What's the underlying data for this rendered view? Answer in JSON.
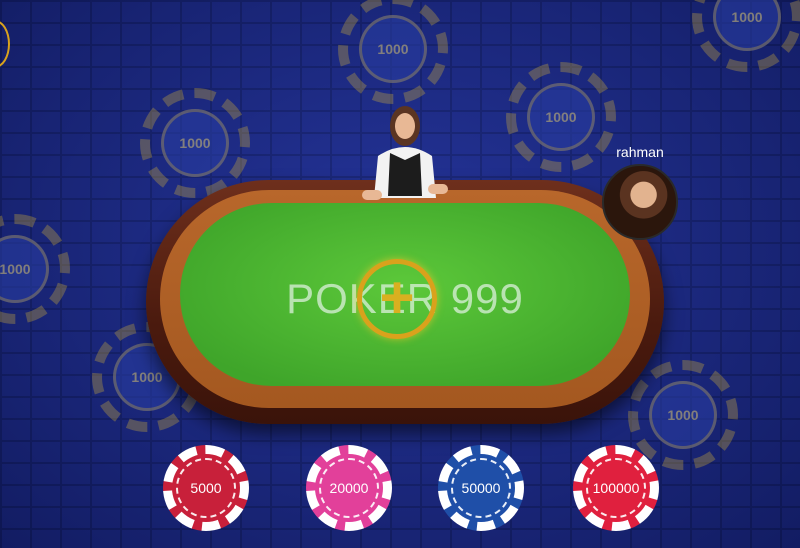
{
  "background_chips": [
    {
      "label": "1000"
    },
    {
      "label": "1000"
    },
    {
      "label": "1000"
    },
    {
      "label": "1000"
    },
    {
      "label": "1000"
    },
    {
      "label": "1000"
    },
    {
      "label": "1000"
    }
  ],
  "table": {
    "logo_text": "POKER 999"
  },
  "player": {
    "name": "rahman"
  },
  "bet_chips": [
    {
      "label": "5000",
      "color": "#c8203a"
    },
    {
      "label": "20000",
      "color": "#e2409a"
    },
    {
      "label": "50000",
      "color": "#1f4fa8"
    },
    {
      "label": "100000",
      "color": "#e0203e"
    }
  ]
}
